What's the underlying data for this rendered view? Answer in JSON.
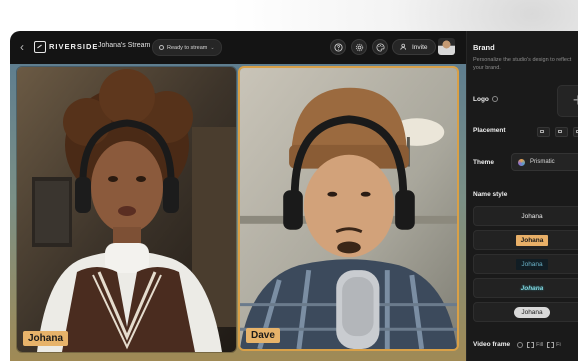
{
  "header": {
    "brand": "RIVERSIDE",
    "stream_name": "Johana's Stream",
    "status": "Ready to stream",
    "invite_label": "Invite"
  },
  "participants": [
    {
      "name": "Johana"
    },
    {
      "name": "Dave"
    }
  ],
  "panel": {
    "title": "Brand",
    "description": "Personalize the studio's design to reflect your brand.",
    "logo_label": "Logo",
    "logo_add": "+",
    "placement_label": "Placement",
    "theme_label": "Theme",
    "theme_value": "Prismatic",
    "name_style_label": "Name style",
    "name_styles": [
      "Johana",
      "Johana",
      "Johana",
      "Johana",
      "Johana"
    ],
    "video_frame_label": "Video frame",
    "video_frame_options": [
      "Fill",
      "Fi"
    ]
  },
  "colors": {
    "accent": "#e7b36a",
    "highlight_border": "#d9a047",
    "app_bg": "#141414",
    "panel_bg": "#1a1a1a"
  },
  "icons": {
    "back": "chevron-left-icon",
    "help": "question-icon",
    "settings": "gear-icon",
    "palette": "palette-icon",
    "invite": "user-plus-icon"
  }
}
